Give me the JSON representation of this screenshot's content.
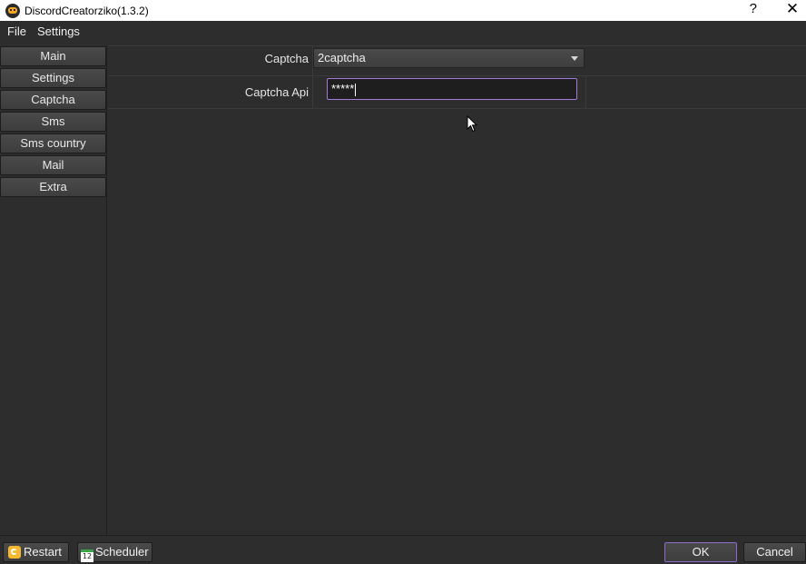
{
  "window": {
    "title": "DiscordCreatorziko(1.3.2)",
    "help_label": "?",
    "close_label": "✕"
  },
  "menu": [
    "File",
    "Settings"
  ],
  "sidebar": {
    "items": [
      "Main",
      "Settings",
      "Captcha",
      "Sms",
      "Sms country",
      "Mail",
      "Extra"
    ]
  },
  "form": {
    "captcha_label": "Captcha",
    "captcha_value": "2captcha",
    "api_label": "Captcha Api",
    "api_value": "*****"
  },
  "footer": {
    "restart_label": "Restart",
    "scheduler_label": "Scheduler",
    "scheduler_icon_text": "12",
    "ok_label": "OK",
    "cancel_label": "Cancel"
  },
  "colors": {
    "background": "#2d2d2d",
    "accent": "#a07ad8"
  }
}
